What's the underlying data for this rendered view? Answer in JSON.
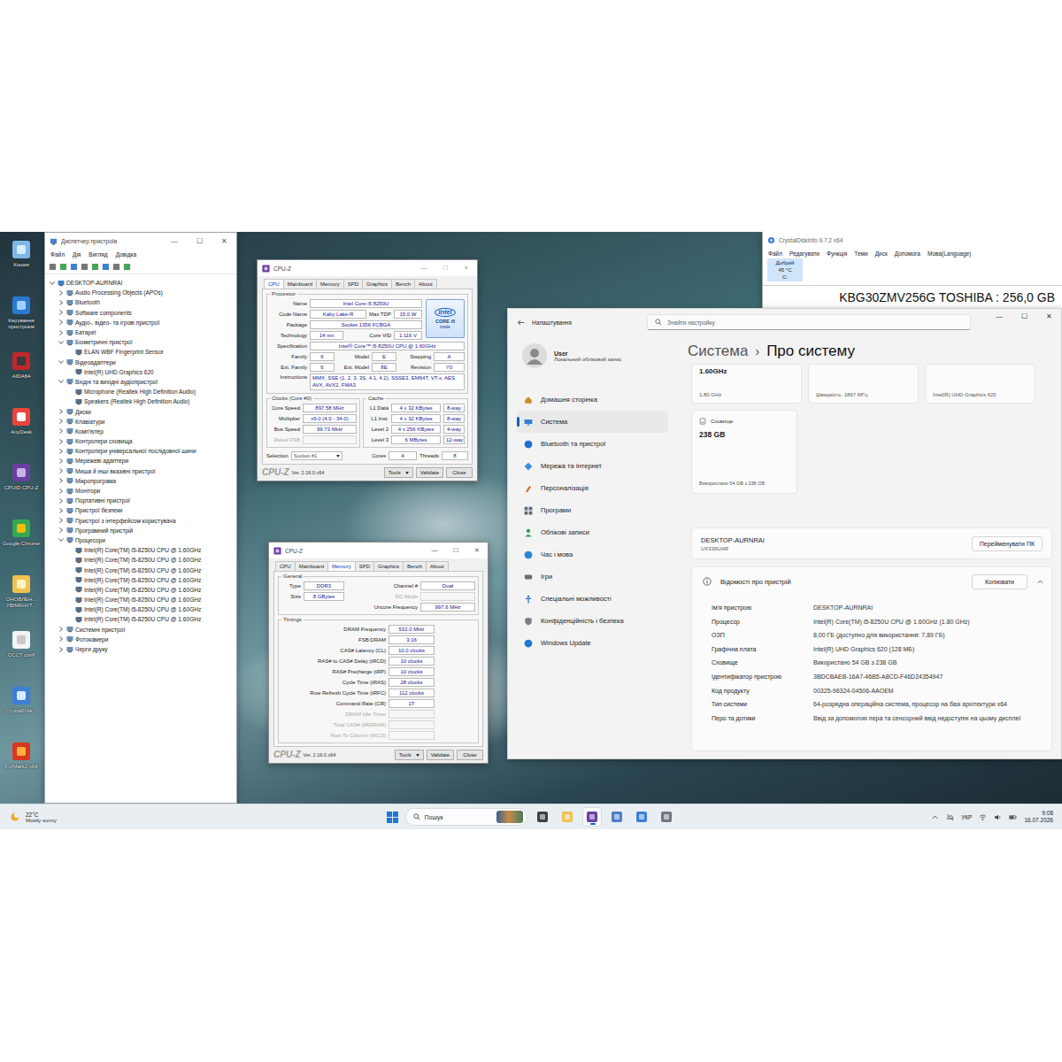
{
  "desktop": {
    "icons": [
      {
        "label": "Кошик"
      },
      {
        "label": "Керування пристроєм"
      },
      {
        "label": "AIDA64"
      },
      {
        "label": "AnyDesk"
      },
      {
        "label": "CPUID CPU-Z"
      },
      {
        "label": "Google Chrome"
      },
      {
        "label": "ОНОВЛЕН... УВІМКНУТ..."
      },
      {
        "label": "OCCT.confi"
      },
      {
        "label": "CrystalDisk..."
      },
      {
        "label": "FurMark2 x64"
      }
    ]
  },
  "window_controls": [
    "—",
    "☐",
    "✕"
  ],
  "device_manager": {
    "title": "Диспетчер пристроїв",
    "menu": [
      "Файл",
      "Дія",
      "Вигляд",
      "Довідка"
    ],
    "tree": {
      "text": "DESKTOP-AURNRAI",
      "expanded": true,
      "children": [
        {
          "text": "Audio Processing Objects (APOs)",
          "expanded": false
        },
        {
          "text": "Bluetooth",
          "expanded": false
        },
        {
          "text": "Software components",
          "expanded": false
        },
        {
          "text": "Аудіо-, відео- та ігрові пристрої",
          "expanded": false
        },
        {
          "text": "Батареї",
          "expanded": false
        },
        {
          "text": "Біометричні пристрої",
          "expanded": true,
          "children": [
            {
              "text": "ELAN WBF Fingerprint Sensor"
            }
          ]
        },
        {
          "text": "Відеоадаптери",
          "expanded": true,
          "children": [
            {
              "text": "Intel(R) UHD Graphics 620"
            }
          ]
        },
        {
          "text": "Вхідні та вихідні аудіопристрої",
          "expanded": true,
          "children": [
            {
              "text": "Microphone (Realtek High Definition Audio)"
            },
            {
              "text": "Speakers (Realtek High Definition Audio)"
            }
          ]
        },
        {
          "text": "Диски",
          "expanded": false
        },
        {
          "text": "Клавіатури",
          "expanded": false
        },
        {
          "text": "Комп'ютер",
          "expanded": false
        },
        {
          "text": "Контролери сховища",
          "expanded": false
        },
        {
          "text": "Контролери універсальної послідовної шини",
          "expanded": false
        },
        {
          "text": "Мережеві адаптери",
          "expanded": false
        },
        {
          "text": "Миша й інші вказівні пристрої",
          "expanded": false
        },
        {
          "text": "Мікропрограма",
          "expanded": false
        },
        {
          "text": "Монітори",
          "expanded": false
        },
        {
          "text": "Портативні пристрої",
          "expanded": false
        },
        {
          "text": "Пристрої безпеки",
          "expanded": false
        },
        {
          "text": "Пристрої з інтерфейсом користувача",
          "expanded": false
        },
        {
          "text": "Програмний пристрій",
          "expanded": false
        },
        {
          "text": "Процесори",
          "expanded": true,
          "children": [
            {
              "text": "Intel(R) Core(TM) i5-8250U CPU @ 1.60GHz"
            },
            {
              "text": "Intel(R) Core(TM) i5-8250U CPU @ 1.60GHz"
            },
            {
              "text": "Intel(R) Core(TM) i5-8250U CPU @ 1.60GHz"
            },
            {
              "text": "Intel(R) Core(TM) i5-8250U CPU @ 1.60GHz"
            },
            {
              "text": "Intel(R) Core(TM) i5-8250U CPU @ 1.60GHz"
            },
            {
              "text": "Intel(R) Core(TM) i5-8250U CPU @ 1.60GHz"
            },
            {
              "text": "Intel(R) Core(TM) i5-8250U CPU @ 1.60GHz"
            },
            {
              "text": "Intel(R) Core(TM) i5-8250U CPU @ 1.60GHz"
            }
          ]
        },
        {
          "text": "Системні пристрої",
          "expanded": false
        },
        {
          "text": "Фотокамери",
          "expanded": false
        },
        {
          "text": "Черги друку",
          "expanded": false
        }
      ]
    }
  },
  "cpuz_cpu": {
    "title": "CPU-Z",
    "tabs": [
      {
        "label": "CPU",
        "selected": true
      },
      {
        "label": "Mainboard",
        "selected": false
      },
      {
        "label": "Memory",
        "selected": false
      },
      {
        "label": "SPD",
        "selected": false
      },
      {
        "label": "Graphics",
        "selected": false
      },
      {
        "label": "Bench",
        "selected": false
      },
      {
        "label": "About",
        "selected": false
      }
    ],
    "processor": {
      "legend": "Processor",
      "name": {
        "label": "Name",
        "value": "Intel Core i5 8250U"
      },
      "code_name": {
        "label": "Code Name",
        "value": "Kaby Lake-R"
      },
      "max_tdp": {
        "label": "Max TDP",
        "value": "15.0 W"
      },
      "package": {
        "label": "Package",
        "value": "Socket 1356 FCBGA"
      },
      "technology": {
        "label": "Technology",
        "value": "14 nm"
      },
      "core_vid": {
        "label": "Core VID",
        "value": "1.116 V"
      },
      "specification": {
        "label": "Specification",
        "value": "Intel® Core™ i5-8250U CPU @ 1.60GHz"
      },
      "family": {
        "label": "Family",
        "value": "6"
      },
      "model": {
        "label": "Model",
        "value": "E"
      },
      "stepping": {
        "label": "Stepping",
        "value": "A"
      },
      "ext_family": {
        "label": "Ext. Family",
        "value": "6"
      },
      "ext_model": {
        "label": "Ext. Model",
        "value": "8E"
      },
      "revision": {
        "label": "Revision",
        "value": "Y0"
      },
      "instructions": {
        "label": "Instructions",
        "value": "MMX, SSE (1, 2, 3, 3S, 4.1, 4.2), SSSE3, EM64T, VT-x, AES, AVX, AVX2, FMA3"
      }
    },
    "logo": {
      "brand": "intel",
      "line1": "CORE i5",
      "line2": "inside"
    },
    "clocks": {
      "legend": "Clocks (Core #0)",
      "rows": [
        {
          "label": "Core Speed",
          "value": "897.58 MHz",
          "disabled": false
        },
        {
          "label": "Multiplier",
          "value": "x9.0 (4.0 - 34.0)",
          "disabled": false
        },
        {
          "label": "Bus Speed",
          "value": "99.73 MHz",
          "disabled": false
        },
        {
          "label": "Rated FSB",
          "value": "",
          "disabled": true
        }
      ]
    },
    "cache": {
      "legend": "Cache",
      "rows": [
        {
          "label": "L1 Data",
          "size": "4 x 32 KBytes",
          "way": "8-way"
        },
        {
          "label": "L1 Inst.",
          "size": "4 x 32 KBytes",
          "way": "8-way"
        },
        {
          "label": "Level 2",
          "size": "4 x 256 KBytes",
          "way": "4-way"
        },
        {
          "label": "Level 3",
          "size": "6 MBytes",
          "way": "12-way"
        }
      ]
    },
    "selection": {
      "label": "Selection",
      "value": "Socket #1",
      "cores_label": "Cores",
      "cores": "4",
      "threads_label": "Threads",
      "threads": "8"
    },
    "footer": {
      "brand": "CPU-Z",
      "version": "Ver. 2.16.0.x64",
      "tools": "Tools",
      "buttons": [
        "Validate",
        "Close"
      ]
    }
  },
  "cpuz_memory": {
    "title": "CPU-Z",
    "tabs": [
      {
        "label": "CPU",
        "selected": false
      },
      {
        "label": "Mainboard",
        "selected": false
      },
      {
        "label": "Memory",
        "selected": true
      },
      {
        "label": "SPD",
        "selected": false
      },
      {
        "label": "Graphics",
        "selected": false
      },
      {
        "label": "Bench",
        "selected": false
      },
      {
        "label": "About",
        "selected": false
      }
    ],
    "general": {
      "legend": "General",
      "left": [
        {
          "label": "Type",
          "value": "DDR3",
          "disabled": false
        },
        {
          "label": "Size",
          "value": "8 GBytes",
          "disabled": false
        }
      ],
      "right": [
        {
          "label": "Channel #",
          "value": "Dual",
          "disabled": false
        },
        {
          "label": "DC Mode",
          "value": "",
          "disabled": true
        },
        {
          "label": "Uncore Frequency",
          "value": "997.6 MHz",
          "disabled": false
        }
      ]
    },
    "timings": {
      "legend": "Timings",
      "rows": [
        {
          "label": "DRAM Frequency",
          "value": "532.0 MHz",
          "disabled": false
        },
        {
          "label": "FSB:DRAM",
          "value": "3:16",
          "disabled": false
        },
        {
          "label": "CAS# Latency (CL)",
          "value": "10.0 clocks",
          "disabled": false
        },
        {
          "label": "RAS# to CAS# Delay (tRCD)",
          "value": "10 clocks",
          "disabled": false
        },
        {
          "label": "RAS# Precharge (tRP)",
          "value": "10 clocks",
          "disabled": false
        },
        {
          "label": "Cycle Time (tRAS)",
          "value": "28 clocks",
          "disabled": false
        },
        {
          "label": "Row Refresh Cycle Time (tRFC)",
          "value": "112 clocks",
          "disabled": false
        },
        {
          "label": "Command Rate (CR)",
          "value": "1T",
          "disabled": false
        },
        {
          "label": "DRAM Idle Timer",
          "value": "",
          "disabled": true
        },
        {
          "label": "Total CAS# (tRDRAM)",
          "value": "",
          "disabled": true
        },
        {
          "label": "Row To Column (tRCD)",
          "value": "",
          "disabled": true
        }
      ]
    },
    "footer": {
      "brand": "CPU-Z",
      "version": "Ver. 2.16.0.x64",
      "tools": "Tools",
      "buttons": [
        "Validate",
        "Close"
      ]
    }
  },
  "settings": {
    "title": "Налаштування",
    "search_placeholder": "Знайти настройку",
    "user": {
      "name": "User",
      "subtitle": "Локальний обліковий запис"
    },
    "nav": [
      {
        "label": "Домашня сторінка",
        "selected": false
      },
      {
        "label": "Система",
        "selected": true
      },
      {
        "label": "Bluetooth та пристрої",
        "selected": false
      },
      {
        "label": "Мережа та Інтернет",
        "selected": false
      },
      {
        "label": "Персоналізація",
        "selected": false
      },
      {
        "label": "Програми",
        "selected": false
      },
      {
        "label": "Облікові записи",
        "selected": false
      },
      {
        "label": "Час і мова",
        "selected": false
      },
      {
        "label": "Ігри",
        "selected": false
      },
      {
        "label": "Спеціальні можливості",
        "selected": false
      },
      {
        "label": "Конфіденційність і безпека",
        "selected": false
      },
      {
        "label": "Windows Update",
        "selected": false
      }
    ],
    "breadcrumb": {
      "parent": "Система",
      "separator": "›",
      "current": "Про систему"
    },
    "top_cards": [
      {
        "lines": [
          "1.60GHz",
          "1.80 GHz"
        ]
      },
      {
        "lines": [
          "Швидкість: 1867 МГц"
        ]
      },
      {
        "lines": [
          "Intel(R) UHD Graphics 620"
        ]
      }
    ],
    "storage_card": {
      "title": "Сховище",
      "value": "238 GB",
      "detail": "Використано 54 GB з 238 GB"
    },
    "device": {
      "name": "DESKTOP-AURNRAI",
      "model": "UX330UAR",
      "rename": "Перейменувати ПК"
    },
    "specs": {
      "title": "Відомості про пристрій",
      "copy": "Копіювати",
      "expanded": true,
      "rows": [
        {
          "label": "Ім'я пристрою",
          "value": "DESKTOP-AURNRAI"
        },
        {
          "label": "Процесор",
          "value": "Intel(R) Core(TM) i5-8250U CPU @ 1.60GHz (1.80 GHz)"
        },
        {
          "label": "ОЗП",
          "value": "8,00 ГБ (доступно для використання: 7,89 ГБ)"
        },
        {
          "label": "Графічна плата",
          "value": "Intel(R) UHD Graphics 620 (128 МБ)"
        },
        {
          "label": "Сховище",
          "value": "Використано 54 GB з 238 GB"
        },
        {
          "label": "Ідентифікатор пристрою",
          "value": "3BDCBAEB-16A7-46B5-A8CD-F46D24354947"
        },
        {
          "label": "Код продукту",
          "value": "00325-96324-04506-AAOEM"
        },
        {
          "label": "Тип системи",
          "value": "64-розрядна операційна система, процесор на базі архітектури x64"
        },
        {
          "label": "Перо та дотики",
          "value": "Ввід за допомогою пера та сенсорний ввід недоступні на цьому дисплеї"
        }
      ]
    }
  },
  "crystaldiskinfo": {
    "title": "CrystalDiskInfo 9.7.2 x64",
    "menu": [
      "Файл",
      "Редагувати",
      "Функція",
      "Теми",
      "Диск",
      "Допомога",
      "Мова(Language)"
    ],
    "health": {
      "status": "Добрий",
      "temperature": "45 °C",
      "drive": "C:"
    },
    "disk": "KBG30ZMV256G TOSHIBA : 256,0 GB"
  },
  "taskbar": {
    "weather": {
      "temp": "22°C",
      "text": "Mostly sunny"
    },
    "search_placeholder": "Пошук",
    "apps": [
      {
        "active": false
      },
      {
        "active": false
      },
      {
        "active": true
      },
      {
        "active": false
      },
      {
        "active": false
      },
      {
        "active": false
      }
    ],
    "language": "УКР",
    "time": "9:08",
    "date": "16.07.2026"
  }
}
